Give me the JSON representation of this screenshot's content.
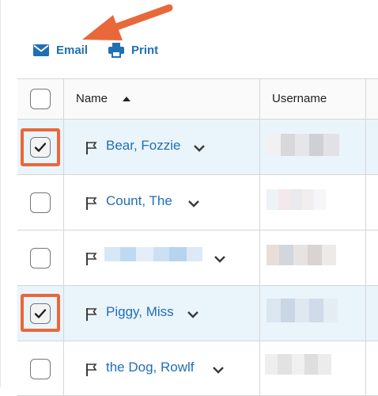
{
  "toolbar": {
    "email_label": "Email",
    "print_label": "Print"
  },
  "table": {
    "columns": {
      "name": "Name",
      "username": "Username"
    },
    "sort": "ascending",
    "rows": [
      {
        "name": "Bear, Fozzie",
        "checked": true
      },
      {
        "name": "Count, The",
        "checked": false
      },
      {
        "name": "",
        "checked": false
      },
      {
        "name": "Piggy, Miss",
        "checked": true
      },
      {
        "name": "the Dog, Rowlf",
        "checked": false
      }
    ]
  },
  "colors": {
    "link": "#1f6fb4",
    "selected_row": "#eaf4fb",
    "annotation": "#e8683b"
  }
}
